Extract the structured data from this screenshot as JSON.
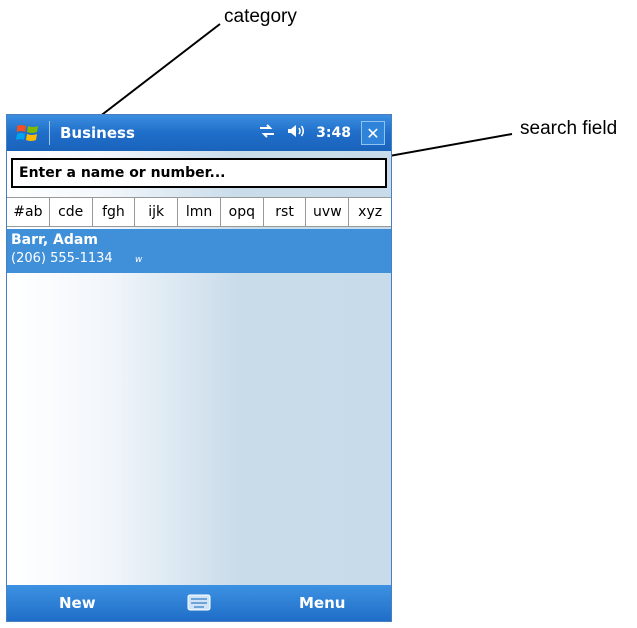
{
  "callouts": {
    "category_label": "category",
    "search_label": "search field"
  },
  "titlebar": {
    "category": "Business",
    "time": "3:48",
    "close_label": "✕"
  },
  "search": {
    "placeholder": "Enter a name or number..."
  },
  "alpha_tabs": [
    "#ab",
    "cde",
    "fgh",
    "ijk",
    "lmn",
    "opq",
    "rst",
    "uvw",
    "xyz"
  ],
  "contacts": [
    {
      "name": "Barr, Adam",
      "phone": "(206) 555-1134",
      "type": "w"
    }
  ],
  "menubar": {
    "left": "New",
    "right": "Menu"
  },
  "colors": {
    "titlebar": "#1f6ec9",
    "selection": "#3f8fd9",
    "menubar": "#1f6dc8"
  }
}
